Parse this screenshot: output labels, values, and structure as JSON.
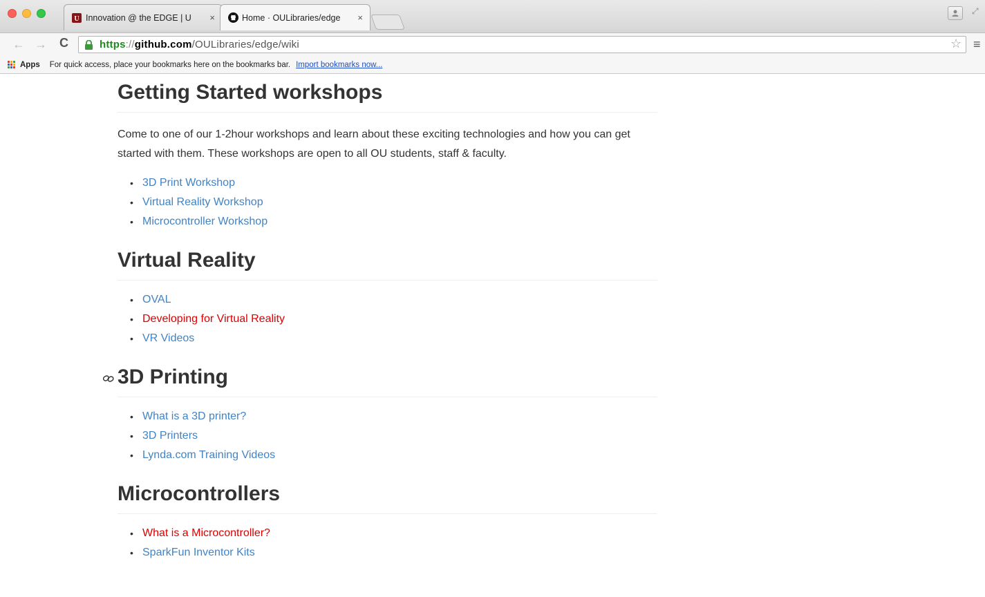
{
  "browser": {
    "tabs": [
      {
        "title": "Innovation @ the EDGE | U",
        "close": "×",
        "active": false
      },
      {
        "title": "Home · OULibraries/edge",
        "close": "×",
        "active": true
      }
    ],
    "url": {
      "scheme": "https",
      "sep": "://",
      "host": "github.com",
      "path": "/OULibraries/edge/wiki"
    },
    "bookmarks_bar": {
      "apps_label": "Apps",
      "hint": "For quick access, place your bookmarks here on the bookmarks bar.",
      "import_link": "Import bookmarks now..."
    }
  },
  "wiki": {
    "getting_started": {
      "heading": "Getting Started workshops",
      "paragraph": "Come to one of our 1-2hour workshops and learn about these exciting technologies and how you can get started with them. These workshops are open to all OU students, staff & faculty.",
      "links": [
        {
          "label": "3D Print Workshop",
          "status": "existing"
        },
        {
          "label": "Virtual Reality Workshop",
          "status": "existing"
        },
        {
          "label": "Microcontroller Workshop",
          "status": "existing"
        }
      ]
    },
    "virtual_reality": {
      "heading": "Virtual Reality",
      "links": [
        {
          "label": "OVAL",
          "status": "existing"
        },
        {
          "label": "Developing for Virtual Reality",
          "status": "missing"
        },
        {
          "label": "VR Videos",
          "status": "existing"
        }
      ]
    },
    "printing_3d": {
      "heading": "3D Printing",
      "links": [
        {
          "label": "What is a 3D printer?",
          "status": "existing"
        },
        {
          "label": "3D Printers",
          "status": "existing"
        },
        {
          "label": "Lynda.com Training Videos",
          "status": "existing"
        }
      ]
    },
    "microcontrollers": {
      "heading": "Microcontrollers",
      "links": [
        {
          "label": "What is a Microcontroller?",
          "status": "missing"
        },
        {
          "label": "SparkFun Inventor Kits",
          "status": "existing"
        }
      ]
    }
  },
  "colors": {
    "link_existing": "#4183c4",
    "link_missing": "#e00000",
    "heading_text": "#333333",
    "url_scheme": "#1a8a1a"
  },
  "icons": {
    "back": "back-arrow-icon",
    "forward": "forward-arrow-icon",
    "reload": "reload-icon",
    "lock": "lock-icon",
    "star": "star-icon",
    "menu": "hamburger-menu-icon",
    "anchor": "link-anchor-icon",
    "apps": "apps-grid-icon"
  }
}
